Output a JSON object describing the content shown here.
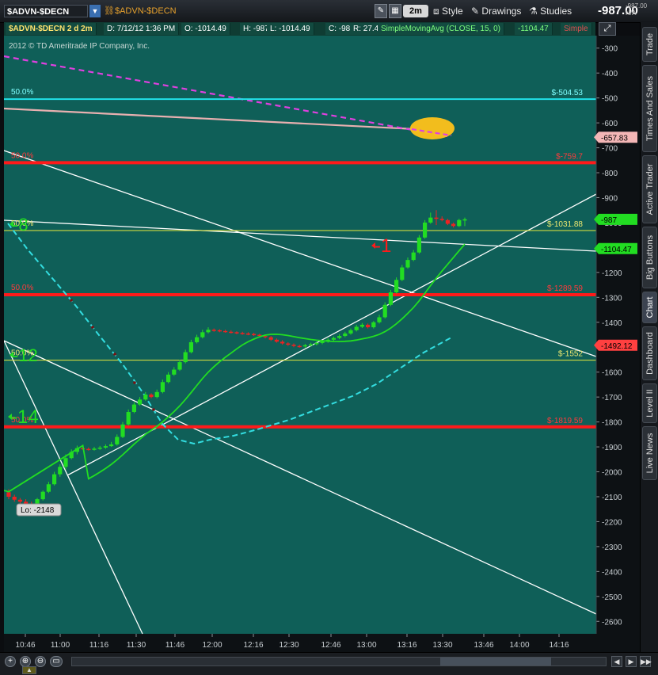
{
  "toolbar": {
    "symbol": "$ADVN-$DECN",
    "symbol_link": "$ADVN-$DECN",
    "timeframe": "2m",
    "style_label": "Style",
    "drawings_label": "Drawings",
    "studies_label": "Studies",
    "last_price": "-987.00",
    "last_price_small": "-987.00",
    "last_change_small": "N/A"
  },
  "infobar": {
    "symbol_period": "$ADVN-$DECN 2 d 2m",
    "date": "D: 7/12/12 1:36 PM",
    "open": "O: -1014.49",
    "high": "H: -987",
    "low": "L: -1014.49",
    "close": "C: -987",
    "range": "R: 27.49",
    "study": "SimpleMovingAvg (CLOSE, 15, 0)",
    "study_value": "-1104.47",
    "study_type": "Simple"
  },
  "side_tabs": [
    "Trade",
    "Times And Sales",
    "Active Trader",
    "Big Buttons",
    "Chart",
    "Dashboard",
    "Level II",
    "Live News"
  ],
  "colors": {
    "chart_bg": "#0f5f58",
    "candle_up": "#22dd22",
    "candle_down": "#ee2222",
    "sma": "#22dd22",
    "cyan_dash": "#33dde0",
    "fib_red": "#ff1a1a",
    "fib_yellow": "#e8e83c",
    "cyan_line": "#22e0e8",
    "magenta": "#e040e0",
    "pink_line": "#e8b0b0",
    "ellipse": "#ffc21a"
  },
  "chart_data": {
    "type": "line",
    "copyright": "2012 © TD Ameritrade IP Company, Inc.",
    "ylim": [
      -2650,
      -250
    ],
    "y_ticks": [
      -300,
      -400,
      -500,
      -600,
      -700,
      -800,
      -900,
      -1000,
      -1100,
      -1200,
      -1300,
      -1400,
      -1500,
      -1600,
      -1700,
      -1800,
      -1900,
      -2000,
      -2100,
      -2200,
      -2300,
      -2400,
      -2500,
      -2600
    ],
    "x_ticks": [
      "10:46",
      "11:00",
      "11:16",
      "11:30",
      "11:46",
      "12:00",
      "12:16",
      "12:30",
      "12:46",
      "13:00",
      "13:16",
      "13:30",
      "13:46",
      "14:00",
      "14:16"
    ],
    "candles": [
      [
        -2082,
        -2100,
        -2070,
        -2110
      ],
      [
        -2100,
        -2112,
        -2092,
        -2120
      ],
      [
        -2112,
        -2120,
        -2105,
        -2130
      ],
      [
        -2120,
        -2132,
        -2110,
        -2140
      ],
      [
        -2132,
        -2138,
        -2120,
        -2148
      ],
      [
        -2138,
        -2110,
        -2105,
        -2145
      ],
      [
        -2110,
        -2080,
        -2075,
        -2115
      ],
      [
        -2080,
        -2050,
        -2040,
        -2085
      ],
      [
        -2050,
        -2010,
        -2000,
        -2055
      ],
      [
        -2010,
        -1980,
        -1970,
        -2020
      ],
      [
        -1980,
        -1945,
        -1930,
        -1990
      ],
      [
        -1945,
        -1920,
        -1910,
        -1950
      ],
      [
        -1920,
        -1905,
        -1895,
        -1930
      ],
      [
        -1905,
        -1908,
        -1898,
        -1912
      ],
      [
        -1908,
        -1910,
        -1902,
        -1915
      ],
      [
        -1910,
        -1907,
        -1900,
        -1915
      ],
      [
        -1907,
        -1903,
        -1896,
        -1912
      ],
      [
        -1903,
        -1897,
        -1890,
        -1908
      ],
      [
        -1897,
        -1890,
        -1880,
        -1900
      ],
      [
        -1890,
        -1860,
        -1850,
        -1895
      ],
      [
        -1860,
        -1810,
        -1800,
        -1865
      ],
      [
        -1810,
        -1760,
        -1750,
        -1815
      ],
      [
        -1760,
        -1730,
        -1720,
        -1765
      ],
      [
        -1730,
        -1710,
        -1700,
        -1735
      ],
      [
        -1710,
        -1690,
        -1680,
        -1715
      ],
      [
        -1690,
        -1700,
        -1685,
        -1705
      ],
      [
        -1700,
        -1680,
        -1670,
        -1705
      ],
      [
        -1680,
        -1640,
        -1630,
        -1685
      ],
      [
        -1640,
        -1610,
        -1600,
        -1645
      ],
      [
        -1610,
        -1590,
        -1580,
        -1615
      ],
      [
        -1590,
        -1560,
        -1550,
        -1595
      ],
      [
        -1560,
        -1520,
        -1510,
        -1565
      ],
      [
        -1520,
        -1480,
        -1470,
        -1525
      ],
      [
        -1480,
        -1460,
        -1450,
        -1485
      ],
      [
        -1460,
        -1440,
        -1430,
        -1465
      ],
      [
        -1440,
        -1430,
        -1420,
        -1445
      ],
      [
        -1430,
        -1432,
        -1425,
        -1438
      ],
      [
        -1432,
        -1435,
        -1428,
        -1440
      ],
      [
        -1435,
        -1438,
        -1430,
        -1442
      ],
      [
        -1438,
        -1440,
        -1432,
        -1445
      ],
      [
        -1440,
        -1443,
        -1436,
        -1448
      ],
      [
        -1443,
        -1445,
        -1438,
        -1450
      ],
      [
        -1445,
        -1447,
        -1440,
        -1452
      ],
      [
        -1447,
        -1450,
        -1442,
        -1455
      ],
      [
        -1450,
        -1455,
        -1446,
        -1460
      ],
      [
        -1455,
        -1460,
        -1450,
        -1465
      ],
      [
        -1460,
        -1470,
        -1455,
        -1475
      ],
      [
        -1470,
        -1478,
        -1465,
        -1482
      ],
      [
        -1478,
        -1485,
        -1472,
        -1490
      ],
      [
        -1485,
        -1490,
        -1480,
        -1495
      ],
      [
        -1490,
        -1495,
        -1485,
        -1500
      ],
      [
        -1495,
        -1497,
        -1490,
        -1502
      ],
      [
        -1497,
        -1492,
        -1487,
        -1502
      ],
      [
        -1492,
        -1488,
        -1482,
        -1497
      ],
      [
        -1488,
        -1483,
        -1477,
        -1493
      ],
      [
        -1483,
        -1477,
        -1471,
        -1488
      ],
      [
        -1477,
        -1470,
        -1464,
        -1482
      ],
      [
        -1470,
        -1463,
        -1457,
        -1475
      ],
      [
        -1463,
        -1455,
        -1448,
        -1468
      ],
      [
        -1455,
        -1445,
        -1438,
        -1460
      ],
      [
        -1445,
        -1432,
        -1425,
        -1450
      ],
      [
        -1432,
        -1418,
        -1410,
        -1437
      ],
      [
        -1418,
        -1410,
        -1403,
        -1423
      ],
      [
        -1410,
        -1420,
        -1405,
        -1425
      ],
      [
        -1420,
        -1400,
        -1395,
        -1425
      ],
      [
        -1400,
        -1380,
        -1370,
        -1405
      ],
      [
        -1380,
        -1330,
        -1320,
        -1385
      ],
      [
        -1330,
        -1280,
        -1270,
        -1335
      ],
      [
        -1280,
        -1230,
        -1220,
        -1285
      ],
      [
        -1230,
        -1180,
        -1170,
        -1235
      ],
      [
        -1180,
        -1150,
        -1140,
        -1185
      ],
      [
        -1150,
        -1120,
        -1110,
        -1155
      ],
      [
        -1120,
        -1060,
        -1050,
        -1125
      ],
      [
        -1060,
        -1000,
        -990,
        -1065
      ],
      [
        -1000,
        -980,
        -960,
        -1005
      ],
      [
        -980,
        -985,
        -950,
        -1010
      ],
      [
        -985,
        -990,
        -975,
        -995
      ],
      [
        -990,
        -1005,
        -985,
        -1010
      ],
      [
        -1005,
        -1014,
        -1000,
        -1020
      ],
      [
        -1014,
        -990,
        -985,
        -1018
      ],
      [
        -990,
        -987,
        -980,
        -1014
      ]
    ],
    "candle_start_index": 0,
    "candle_spacing": 3,
    "sma_label_value": "-1104.47",
    "fib_levels": [
      {
        "value": -504.53,
        "label": "$-504.53",
        "pct": "50.0%",
        "color": "cyan"
      },
      {
        "value": -759.7,
        "label": "$-759.7",
        "pct": "50.0%",
        "color": "red"
      },
      {
        "value": -1031.88,
        "label": "$-1031.88",
        "pct": "50.0%",
        "color": "yellow"
      },
      {
        "value": -1289.59,
        "label": "$-1289.59",
        "pct": "50.0%",
        "color": "red"
      },
      {
        "value": -1552,
        "label": "$-1552",
        "pct": "50.0%",
        "color": "yellow"
      },
      {
        "value": -1819.59,
        "label": "$-1819.59",
        "pct": "50.0%",
        "color": "red"
      }
    ],
    "price_bubbles": [
      {
        "value": -657.83,
        "label": "-657.83",
        "bg": "#f3b6b6",
        "fg": "#000"
      },
      {
        "value": -987,
        "label": "-987",
        "bg": "#22dd22",
        "fg": "#000"
      },
      {
        "value": -1104.47,
        "label": "-1104.47",
        "bg": "#22dd22",
        "fg": "#000"
      },
      {
        "value": -1492.12,
        "label": "-1492.12",
        "bg": "#ff4040",
        "fg": "#000"
      }
    ],
    "annotations": [
      {
        "text": "-8",
        "color": "#22dd22"
      },
      {
        "text": "-12",
        "color": "#22dd22"
      },
      {
        "text": "-14",
        "color": "#22dd22"
      },
      {
        "text": "-1",
        "color": "#ff1a1a"
      }
    ],
    "low_label": "Lo: -2148"
  }
}
